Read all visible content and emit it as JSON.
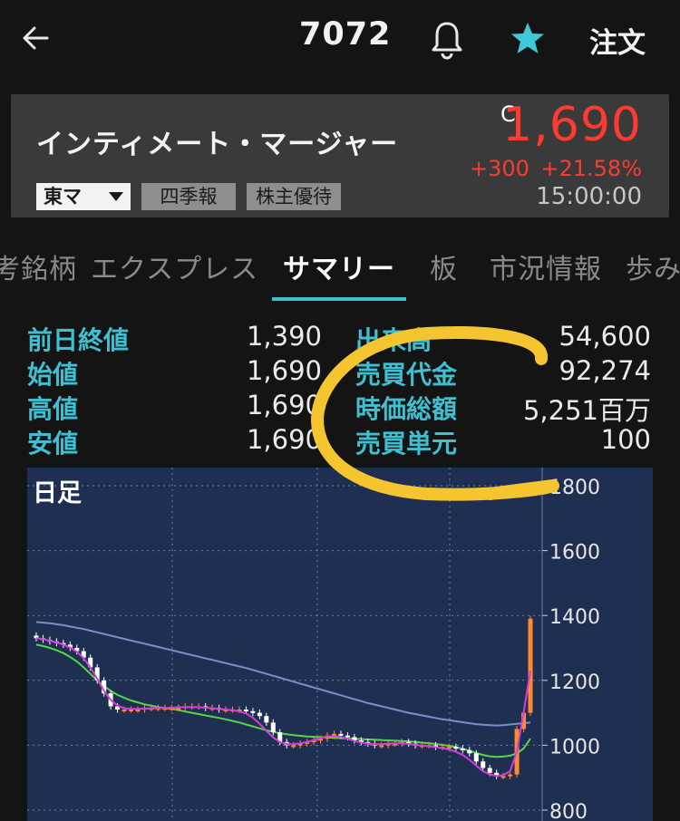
{
  "header": {
    "stock_code": "7072",
    "order_label": "注文",
    "icons": [
      "back-arrow-icon",
      "bell-icon",
      "star-icon"
    ],
    "star_color": "#3fc8d8"
  },
  "quote": {
    "name": "インティメート・マージャー",
    "close_mark": "C",
    "price": "1,690",
    "change": "+300",
    "change_pct": "+21.58%",
    "time": "15:00:00",
    "market": "東マ",
    "tags": [
      "四季報",
      "株主優待"
    ],
    "price_color": "#ff3b30"
  },
  "tabs": [
    {
      "label": "考銘柄",
      "active": false
    },
    {
      "label": "エクスプレス",
      "active": false
    },
    {
      "label": "サマリー",
      "active": true
    },
    {
      "label": "板",
      "active": false
    },
    {
      "label": "市況情報",
      "active": false
    },
    {
      "label": "歩み",
      "active": false
    }
  ],
  "summary": {
    "left": [
      {
        "label": "前日終値",
        "value": "1,390"
      },
      {
        "label": "始値",
        "value": "1,690"
      },
      {
        "label": "高値",
        "value": "1,690"
      },
      {
        "label": "安値",
        "value": "1,690"
      }
    ],
    "right": [
      {
        "label": "出来高",
        "value": "54,600"
      },
      {
        "label": "売買代金",
        "value": "92,274"
      },
      {
        "label": "時価総額",
        "value": "5,251百万"
      },
      {
        "label": "売買単元",
        "value": "100"
      }
    ]
  },
  "chart_data": {
    "type": "candlestick",
    "title": "日足",
    "y_ticks": [
      "1800",
      "1600",
      "1400",
      "1200",
      "1000",
      "800"
    ],
    "ylim": [
      800,
      1800
    ],
    "grid": true,
    "closes": [
      1330,
      1325,
      1320,
      1315,
      1310,
      1300,
      1290,
      1270,
      1240,
      1200,
      1160,
      1120,
      1110,
      1110,
      1110,
      1110,
      1115,
      1115,
      1115,
      1115,
      1115,
      1115,
      1120,
      1120,
      1120,
      1115,
      1115,
      1110,
      1110,
      1110,
      1110,
      1105,
      1100,
      1090,
      1070,
      1040,
      1010,
      1000,
      1000,
      1005,
      1010,
      1015,
      1020,
      1030,
      1035,
      1030,
      1025,
      1015,
      1010,
      1005,
      1000,
      1000,
      1005,
      1005,
      1010,
      1005,
      1000,
      1000,
      1000,
      995,
      995,
      995,
      990,
      985,
      975,
      950,
      930,
      915,
      905,
      905,
      910,
      1050,
      1100,
      1390
    ],
    "ma_short": [
      1330,
      1327,
      1322,
      1317,
      1310,
      1301,
      1288,
      1268,
      1240,
      1205,
      1168,
      1140,
      1122,
      1114,
      1112,
      1112,
      1113,
      1114,
      1115,
      1115,
      1116,
      1117,
      1118,
      1118,
      1117,
      1116,
      1114,
      1112,
      1110,
      1108,
      1104,
      1098,
      1085,
      1066,
      1044,
      1024,
      1010,
      1004,
      1003,
      1006,
      1010,
      1016,
      1022,
      1027,
      1028,
      1026,
      1020,
      1013,
      1008,
      1005,
      1003,
      1003,
      1005,
      1006,
      1006,
      1004,
      1001,
      999,
      997,
      994,
      991,
      987,
      980,
      970,
      955,
      937,
      920,
      910,
      905,
      908,
      920,
      980,
      1100,
      1230
    ],
    "ma_mid": [
      1310,
      1306,
      1300,
      1293,
      1284,
      1272,
      1258,
      1240,
      1220,
      1200,
      1182,
      1168,
      1155,
      1146,
      1138,
      1132,
      1126,
      1122,
      1118,
      1115,
      1112,
      1108,
      1104,
      1100,
      1096,
      1092,
      1088,
      1084,
      1080,
      1075,
      1070,
      1064,
      1058,
      1052,
      1046,
      1041,
      1037,
      1034,
      1031,
      1029,
      1027,
      1026,
      1025,
      1024,
      1023,
      1022,
      1021,
      1020,
      1019,
      1018,
      1017,
      1016,
      1015,
      1014,
      1013,
      1012,
      1010,
      1008,
      1006,
      1004,
      1001,
      998,
      994,
      989,
      983,
      976,
      970,
      966,
      964,
      965,
      968,
      975,
      990,
      1020
    ],
    "ma_long": [
      1380,
      1378,
      1376,
      1373,
      1370,
      1366,
      1362,
      1358,
      1353,
      1348,
      1343,
      1338,
      1333,
      1328,
      1323,
      1318,
      1313,
      1308,
      1303,
      1298,
      1293,
      1288,
      1283,
      1278,
      1273,
      1268,
      1263,
      1258,
      1253,
      1248,
      1243,
      1238,
      1232,
      1226,
      1220,
      1214,
      1208,
      1202,
      1196,
      1190,
      1184,
      1178,
      1172,
      1166,
      1160,
      1154,
      1148,
      1142,
      1136,
      1130,
      1125,
      1120,
      1115,
      1110,
      1105,
      1100,
      1096,
      1092,
      1088,
      1084,
      1080,
      1077,
      1074,
      1071,
      1068,
      1065,
      1063,
      1062,
      1061,
      1062,
      1064,
      1066,
      1068,
      1070
    ],
    "colors": {
      "up": "#ff8a30",
      "down": "#ffffff",
      "ma_short": "#d23fd8",
      "ma_mid": "#55d648",
      "ma_long": "#7b8ec8",
      "grid": "#6d7ea6"
    }
  },
  "annotation": {
    "color": "#f5c530"
  }
}
